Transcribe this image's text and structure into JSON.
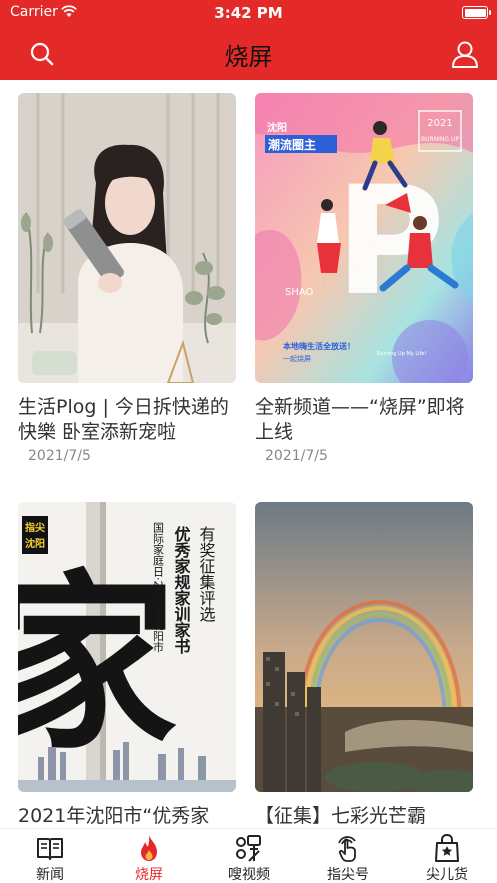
{
  "status": {
    "carrier": "Carrier",
    "time": "3:42 PM"
  },
  "header": {
    "title": "烧屏",
    "left_icon": "search-icon",
    "right_icon": "user-icon"
  },
  "feed": [
    {
      "title": "生活Plog | 今日拆快递的快樂 卧室添新宠啦",
      "date": "2021/7/5"
    },
    {
      "title": "全新频道——“烧屏”即将上线",
      "date": "2021/7/5"
    },
    {
      "title": "2021年沈阳市“优秀家",
      "date": ""
    },
    {
      "title": "【征集】七彩光芒霸",
      "date": ""
    }
  ],
  "card_art": {
    "poster_city": "沈阳",
    "poster_headline": "潮流圈主",
    "poster_year": "2021",
    "poster_tag": "BURNING UP",
    "poster_letter": "P",
    "poster_brand": "SHAO",
    "poster_footer": "本地嗨生活全放送！",
    "poster_cta": "一起烧屏",
    "poster_credit": "Burning Up My Life!",
    "calli_logo_top": "指尖",
    "calli_logo_bottom": "沈阳",
    "calli_glyph": "家",
    "calli_col1": "国际家庭日·2021年沈阳市",
    "calli_col2": "优秀家规家训家书",
    "calli_col3": "有奖征集评选"
  },
  "tabs": [
    {
      "label": "新闻",
      "icon": "book-icon"
    },
    {
      "label": "烧屏",
      "icon": "flame-icon"
    },
    {
      "label": "嗖视频",
      "icon": "sou-video-icon"
    },
    {
      "label": "指尖号",
      "icon": "finger-tap-icon"
    },
    {
      "label": "尖儿货",
      "icon": "shopping-bag-icon"
    }
  ],
  "active_tab": "烧屏",
  "colors": {
    "brand_red": "#e42a28",
    "text_dark": "#333333",
    "date_gray": "#888888"
  }
}
